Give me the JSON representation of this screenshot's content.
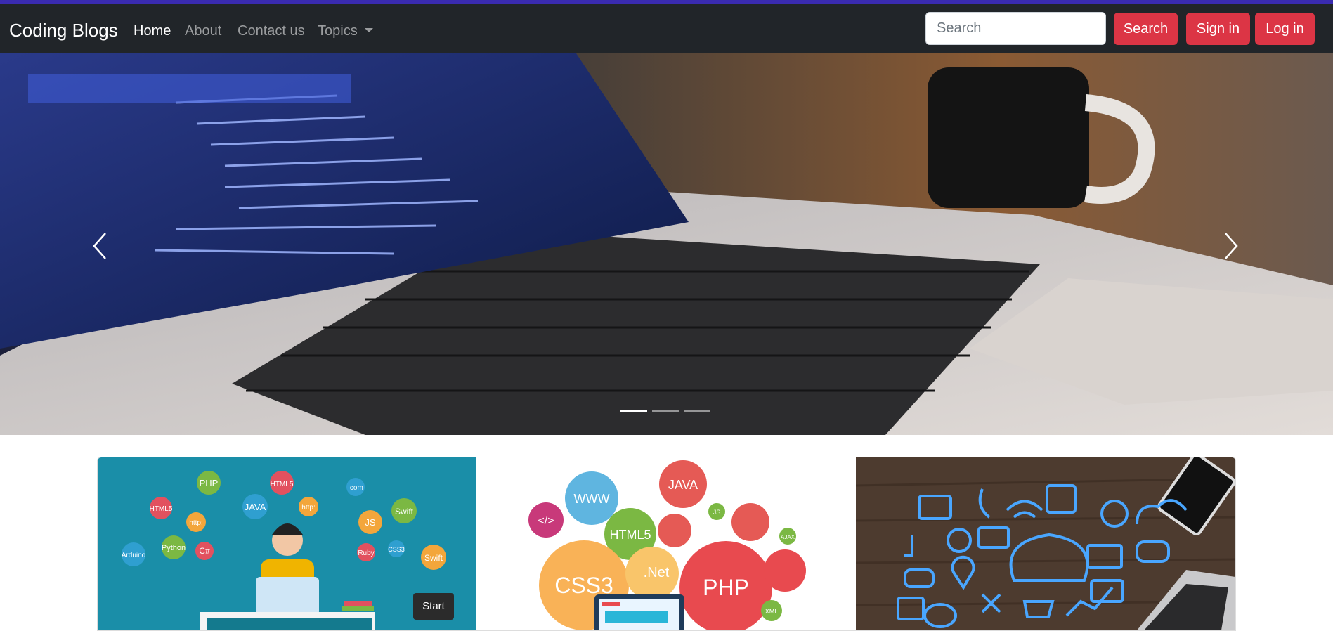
{
  "navbar": {
    "brand": "Coding Blogs",
    "links": [
      {
        "label": "Home",
        "active": true
      },
      {
        "label": "About",
        "active": false
      },
      {
        "label": "Contact us",
        "active": false
      },
      {
        "label": "Topics",
        "active": false,
        "dropdown": true
      }
    ],
    "search_placeholder": "Search",
    "buttons": {
      "search": "Search",
      "signin": "Sign in",
      "login": "Log in"
    }
  },
  "carousel": {
    "slide_count": 3,
    "active_index": 0,
    "hero_icon": "laptop-code-photo"
  },
  "cards": [
    {
      "image": "developer-illustration",
      "bubbles": [
        "PHP",
        "HTML5",
        "JAVA",
        "http:",
        ".com",
        "HTML5",
        "http:",
        "JS",
        "Swift",
        "Arduino",
        "Python",
        "C#",
        "Ruby",
        "CSS3",
        "Swift",
        "<->",
        "</>",
        "</>"
      ],
      "start_label": "Start"
    },
    {
      "image": "web-tech-bubbles",
      "bubbles": [
        "WWW",
        "JAVA",
        "</>",
        "HTML5",
        "JS",
        "CSS3",
        ".Net",
        "PHP",
        "AJAX",
        "XML"
      ]
    },
    {
      "image": "tech-icons-desk-photo"
    }
  ],
  "colors": {
    "navbar": "#212529",
    "button": "#dc3545",
    "accent_topline": "#3a2bb0"
  }
}
